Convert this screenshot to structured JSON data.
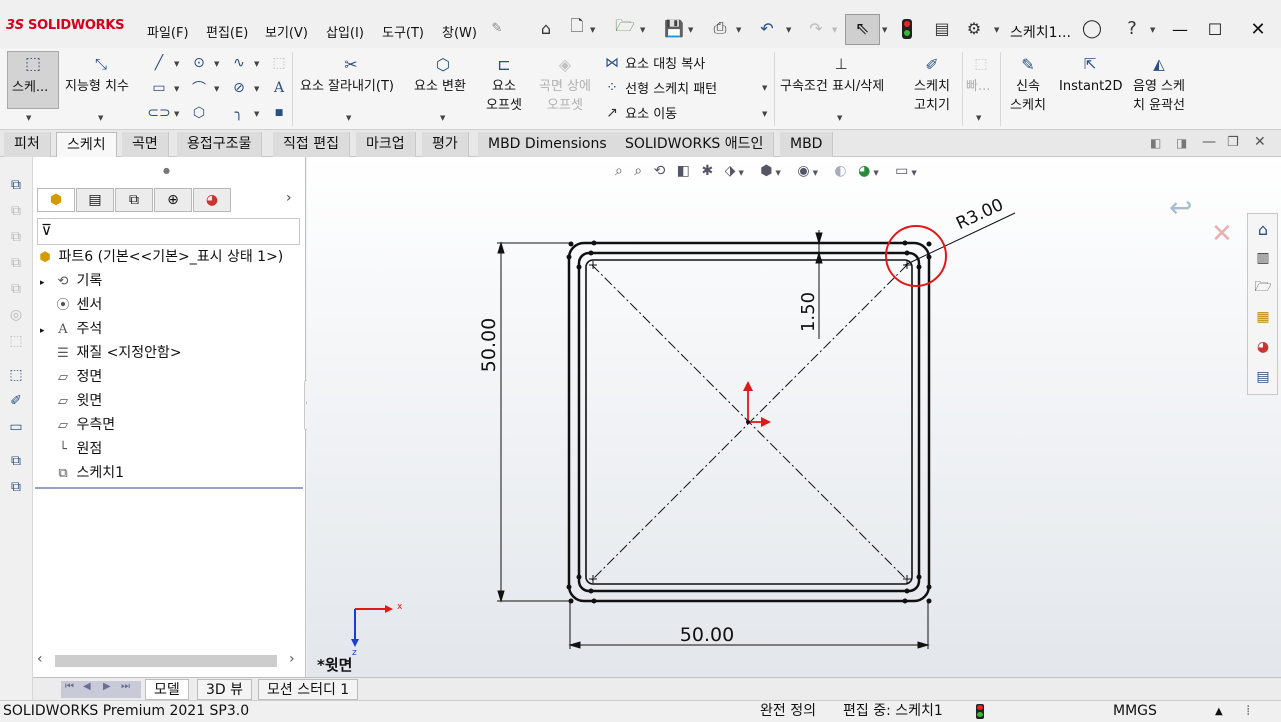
{
  "app": {
    "logo_text": "SOLIDWORKS",
    "logo_prefix": "3S",
    "doc_title": "스케치1...",
    "menu": [
      "파일(F)",
      "편집(E)",
      "보기(V)",
      "삽입(I)",
      "도구(T)",
      "창(W)"
    ]
  },
  "command_manager": {
    "sketch_btn": "스케...",
    "smart_dim": "지능형 치수",
    "trim": "요소 잘라내기(T)",
    "convert": "요소 변환",
    "offset_line1": "요소",
    "offset_line2": "오프셋",
    "offset_surface_line1": "곡면 상에",
    "offset_surface_line2": "오프셋",
    "mirror": "요소 대칭 복사",
    "linear_pattern": "선형 스케치 패턴",
    "move": "요소 이동",
    "relations": "구속조건 표시/삭제",
    "repair_line1": "스케치",
    "repair_line2": "고치기",
    "quick_snaps": "빠...",
    "rapid_line1": "신속",
    "rapid_line2": "스케치",
    "instant2d": "Instant2D",
    "shaded_line1": "음영 스케",
    "shaded_line2": "치 윤곽선"
  },
  "tabs": [
    "피처",
    "스케치",
    "곡면",
    "용접구조물",
    "직접 편집",
    "마크업",
    "평가",
    "MBD Dimensions",
    "SOLIDWORKS 애드인",
    "MBD"
  ],
  "active_tab": "스케치",
  "feature_tree": {
    "root": "파트6  (기본<<기본>_표시 상태 1>)",
    "items": [
      {
        "label": "기록",
        "icon": "history-icon",
        "expandable": true
      },
      {
        "label": "센서",
        "icon": "sensor-icon",
        "expandable": false
      },
      {
        "label": "주석",
        "icon": "annotation-icon",
        "expandable": true
      },
      {
        "label": "재질 <지정안함>",
        "icon": "material-icon",
        "expandable": false
      },
      {
        "label": "정면",
        "icon": "plane-icon",
        "expandable": false
      },
      {
        "label": "윗면",
        "icon": "plane-icon",
        "expandable": false
      },
      {
        "label": "우측면",
        "icon": "plane-icon",
        "expandable": false
      },
      {
        "label": "원점",
        "icon": "origin-icon",
        "expandable": false
      },
      {
        "label": "스케치1",
        "icon": "sketch-icon",
        "expandable": false
      }
    ]
  },
  "graphics": {
    "view_name": "*윗면",
    "dim_width": "50.00",
    "dim_height": "50.00",
    "dim_offset": "1.50",
    "dim_radius": "R3.00",
    "triad_x": "x",
    "triad_z": "z"
  },
  "bottom_tabs": [
    "모델",
    "3D 뷰",
    "모션 스터디 1"
  ],
  "active_bottom_tab": "모델",
  "status": {
    "product": "SOLIDWORKS Premium 2021 SP3.0",
    "definition": "완전 정의",
    "editing": "편집 중: 스케치1",
    "units": "MMGS"
  },
  "colors": {
    "accent": "#d6001c",
    "sketch_line": "#111111",
    "highlight_circle": "#e01818",
    "axis_red": "#e01818",
    "axis_blue": "#1a3fd0"
  }
}
